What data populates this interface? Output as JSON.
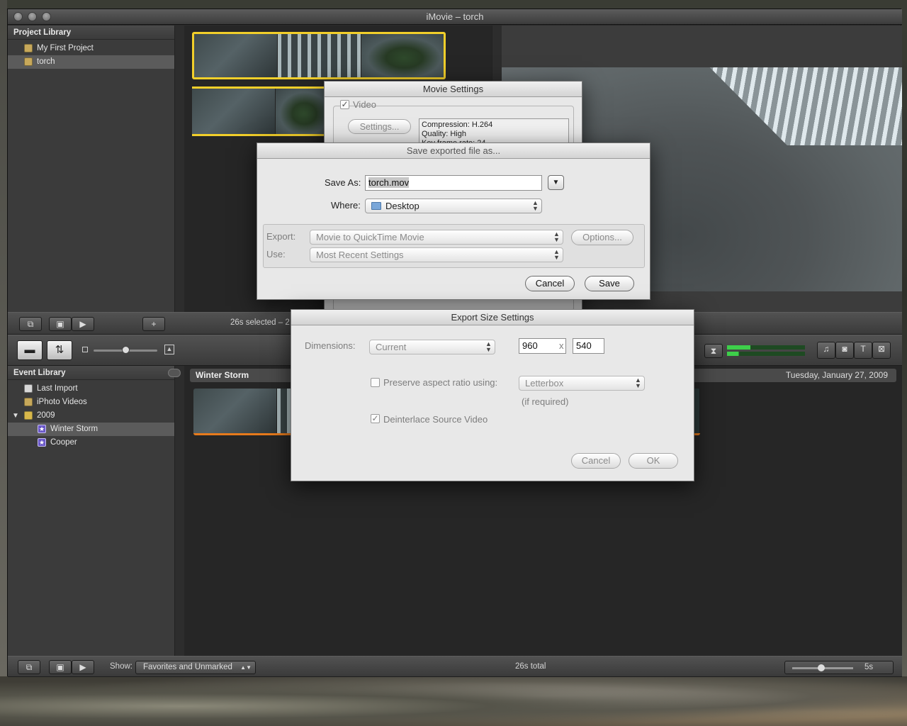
{
  "window": {
    "title": "iMovie – torch"
  },
  "project_library": {
    "header": "Project Library",
    "items": [
      {
        "label": "My First Project"
      },
      {
        "label": "torch"
      }
    ]
  },
  "project_toolbar": {
    "status": "26s selected – 2"
  },
  "middle_toolbar": {},
  "event_library": {
    "header": "Event Library",
    "items": [
      {
        "label": "Last Import"
      },
      {
        "label": "iPhoto Videos"
      },
      {
        "label": "2009"
      },
      {
        "label": "Winter Storm"
      },
      {
        "label": "Cooper"
      }
    ]
  },
  "event_browser": {
    "event_name": "Winter Storm",
    "date": "Tuesday, January 27, 2009"
  },
  "bottom_toolbar": {
    "show_label": "Show:",
    "show_value": "Favorites and Unmarked",
    "total": "26s total",
    "zoom": "5s"
  },
  "movie_settings": {
    "title": "Movie Settings",
    "video_label": "Video",
    "settings_button": "Settings...",
    "info_lines": [
      "Compression: H.264",
      "Quality: High",
      "Key frame rate: 24"
    ]
  },
  "save_dialog": {
    "title": "Save exported file as...",
    "save_as_label": "Save As:",
    "filename": "torch.mov",
    "where_label": "Where:",
    "where_value": "Desktop",
    "export_label": "Export:",
    "export_value": "Movie to QuickTime Movie",
    "options_button": "Options...",
    "use_label": "Use:",
    "use_value": "Most Recent Settings",
    "cancel": "Cancel",
    "save": "Save"
  },
  "export_size": {
    "title": "Export Size Settings",
    "dimensions_label": "Dimensions:",
    "dimensions_value": "Current",
    "width": "960",
    "times": "x",
    "height": "540",
    "preserve_label": "Preserve aspect ratio using:",
    "preserve_value": "Letterbox",
    "if_required": "(if required)",
    "deinterlace_label": "Deinterlace Source Video",
    "cancel": "Cancel",
    "ok": "OK"
  }
}
